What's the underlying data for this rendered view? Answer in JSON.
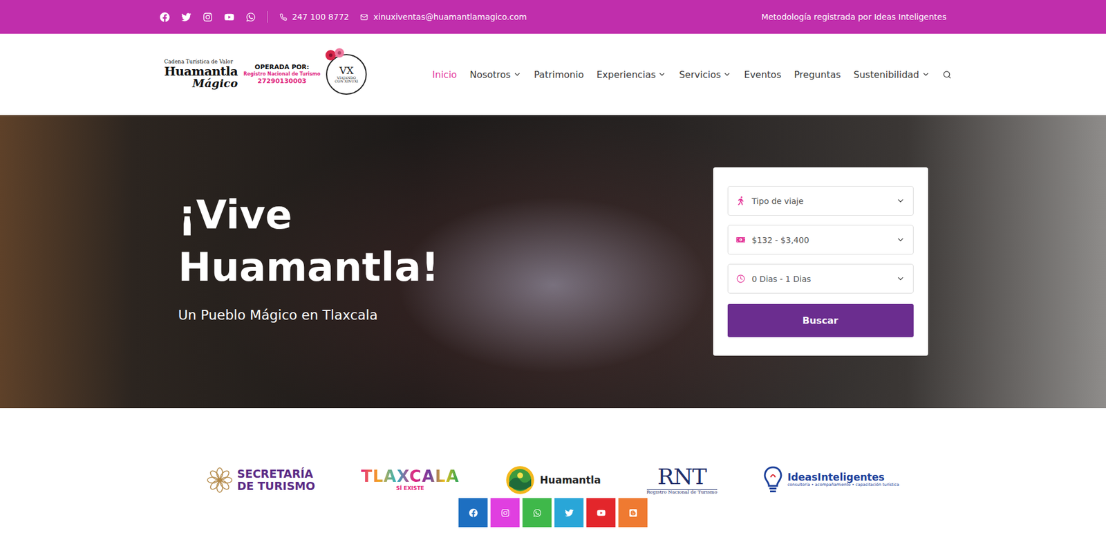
{
  "top_bar": {
    "phone": "247 100 8772",
    "email": "xinuxiventas@huamantlamagico.com",
    "note": "Metodología registrada por Ideas Inteligentes"
  },
  "logo": {
    "tagline": "Cadena Turística de Valor",
    "name": "Huamantla",
    "script": "Mágico",
    "operated_by": "OPERADA POR:",
    "registry_label": "Registro Nacional de Turismo",
    "registry_number": "27290130003",
    "badge": "VX",
    "badge_line1": "VIAJANDO",
    "badge_line2": "CON XINUXI"
  },
  "nav": [
    {
      "label": "Inicio",
      "selected": true,
      "dropdown": false
    },
    {
      "label": "Nosotros",
      "selected": false,
      "dropdown": true
    },
    {
      "label": "Patrimonio",
      "selected": false,
      "dropdown": false
    },
    {
      "label": "Experiencias",
      "selected": false,
      "dropdown": true
    },
    {
      "label": "Servicios",
      "selected": false,
      "dropdown": true
    },
    {
      "label": "Eventos",
      "selected": false,
      "dropdown": false
    },
    {
      "label": "Preguntas",
      "selected": false,
      "dropdown": false
    },
    {
      "label": "Sustenibilidad",
      "selected": false,
      "dropdown": true
    }
  ],
  "hero": {
    "title": "¡Vive Huamantla!",
    "subtitle": "Un Pueblo Mágico en Tlaxcala"
  },
  "search_card": {
    "fields": [
      {
        "kind": "trip",
        "value": "Tipo de viaje"
      },
      {
        "kind": "price",
        "value": "$132 - $3,400"
      },
      {
        "kind": "days",
        "value": "0 Dias - 1 Dias"
      }
    ],
    "button": "Buscar"
  },
  "partners": [
    {
      "kind": "sectur",
      "lines": [
        "SECRETARÍA",
        "DE TURISMO"
      ]
    },
    {
      "kind": "tlaxcala",
      "lines": [
        "TLAXCALA",
        "SÍ EXISTE"
      ]
    },
    {
      "kind": "huamantla",
      "lines": [
        "Huamantla"
      ]
    },
    {
      "kind": "rnt",
      "lines": [
        "RNT",
        "Registro Nacional de Turismo"
      ]
    },
    {
      "kind": "ideas",
      "lines": [
        "IdeasInteligentes",
        "consultoría • acompañamiento • capacitación turística"
      ]
    }
  ],
  "social_buttons": [
    {
      "color": "#1d6fc1"
    },
    {
      "color": "#e03fe0"
    },
    {
      "color": "#3fb84a"
    },
    {
      "color": "#29a6d8"
    },
    {
      "color": "#e3262b"
    },
    {
      "color": "#ef7a31"
    }
  ]
}
